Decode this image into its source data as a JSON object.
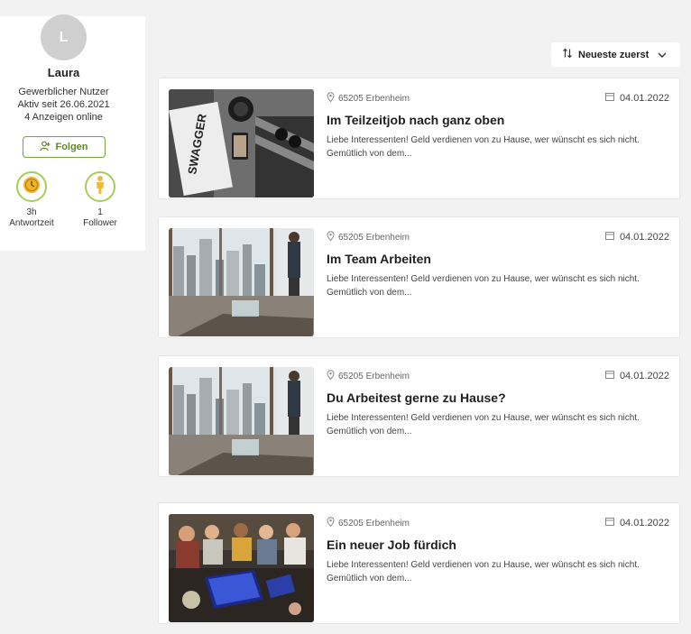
{
  "profile": {
    "avatar_initial": "L",
    "name": "Laura",
    "type": "Gewerblicher Nutzer",
    "active_since": "Aktiv seit 26.06.2021",
    "ads_online": "4 Anzeigen online",
    "follow_label": "Folgen",
    "stats": [
      {
        "value": "3h",
        "label": "Antwortzeit",
        "icon": "clock-icon"
      },
      {
        "value": "1",
        "label": "Follower",
        "icon": "person-icon"
      }
    ]
  },
  "sort": {
    "label": "Neueste zuerst",
    "icon": "sort-icon"
  },
  "colors": {
    "accent": "#7aa53a",
    "ring": "#a8cc58",
    "clock": "#f0b429",
    "person": "#f3b73b"
  },
  "listings": [
    {
      "location": "65205 Erbenheim",
      "date": "04.01.2022",
      "title": "Im Teilzeitjob nach ganz oben",
      "description": "Liebe Interessenten! Geld verdienen von zu Hause, wer wünscht es sich nicht. Gemütlich von dem...",
      "image": "desk-flatlay-photo"
    },
    {
      "location": "65205 Erbenheim",
      "date": "04.01.2022",
      "title": "Im Team Arbeiten",
      "description": "Liebe Interessenten! Geld verdienen von zu Hause, wer wünscht es sich nicht. Gemütlich von dem...",
      "image": "office-window-photo"
    },
    {
      "location": "65205 Erbenheim",
      "date": "04.01.2022",
      "title": "Du Arbeitest gerne zu Hause?",
      "description": "Liebe Interessenten! Geld verdienen von zu Hause, wer wünscht es sich nicht. Gemütlich von dem...",
      "image": "office-window-photo"
    },
    {
      "location": "65205 Erbenheim",
      "date": "04.01.2022",
      "title": "Ein neuer Job fürdich",
      "description": "Liebe Interessenten! Geld verdienen von zu Hause, wer wünscht es sich nicht. Gemütlich von dem...",
      "image": "team-meeting-photo"
    }
  ]
}
